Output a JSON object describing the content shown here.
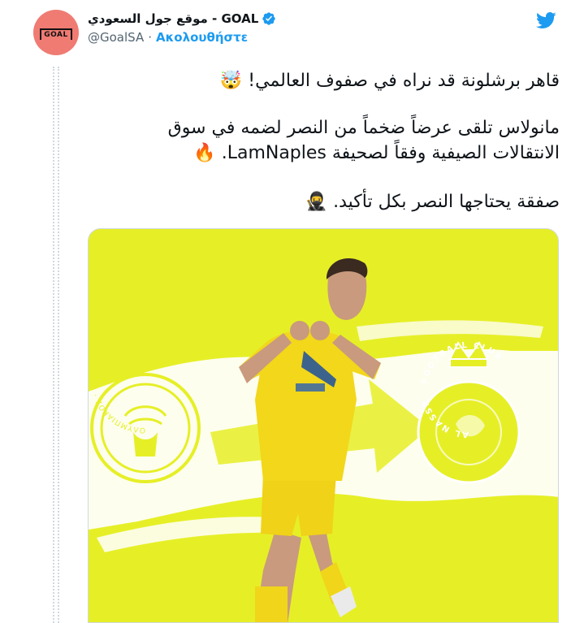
{
  "header": {
    "display_name": "موقع جول السعودي - GOAL",
    "handle": "@GoalSA",
    "separator": "·",
    "follow_label": "Ακολουθήστε",
    "avatar_text": "GOAL"
  },
  "tweet": {
    "line1": "قاهر برشلونة قد نراه في صفوف العالمي!",
    "line1_emoji": "🤯",
    "line2a": "مانولاس تلقى عرضاً ضخماً من النصر لضمه في سوق",
    "line2b": "الانتقالات الصيفية وفقاً لصحيفة LamNaples.",
    "line2_emoji": "🔥",
    "line3": "صفقة يحتاجها النصر بكل تأكيد.",
    "line3_emoji": "🥷"
  },
  "media": {
    "left_crest_text": "ΟΛΥΜΠΙΑΚΟΣ · ΣΥΝΔΕΣΜΟΣ ΦΙΛΑΘΛΩΝ ΠΕΙΡΑΙΩΣ",
    "right_crest_text": "AL NASSR · FOOTBALL CLUB",
    "background_color": "#e6ef26"
  },
  "colors": {
    "accent": "#1d9bf0",
    "avatar_bg": "#ef7b73",
    "text": "#0f1419",
    "muted": "#536471"
  }
}
